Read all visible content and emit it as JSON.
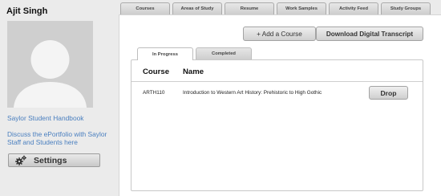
{
  "user": {
    "name": "Ajit Singh"
  },
  "sidebar": {
    "links": [
      {
        "label": "Saylor Student Handbook"
      },
      {
        "label": "Discuss the ePortfolio with Saylor Staff and Students here"
      }
    ],
    "settings_label": "Settings",
    "settings_icon": "gears-icon"
  },
  "top_tabs": [
    {
      "label": "Courses"
    },
    {
      "label": "Areas of Study"
    },
    {
      "label": "Resume"
    },
    {
      "label": "Work Samples"
    },
    {
      "label": "Activity Feed"
    },
    {
      "label": "Study Groups"
    }
  ],
  "actions": {
    "add_course": "+ Add a Course",
    "download_transcript": "Download Digital Transcript"
  },
  "inner_tabs": [
    {
      "label": "In Progress",
      "active": true
    },
    {
      "label": "Completed",
      "active": false
    }
  ],
  "table": {
    "headers": {
      "course": "Course",
      "name": "Name"
    },
    "rows": [
      {
        "code": "ARTH110",
        "name": "Introduction to Western Art History: Prehistoric to High Gothic",
        "action": "Drop"
      }
    ]
  },
  "colors": {
    "link": "#4a7fbf",
    "background": "#ebebeb",
    "avatar_bg": "#cfcfcf"
  }
}
